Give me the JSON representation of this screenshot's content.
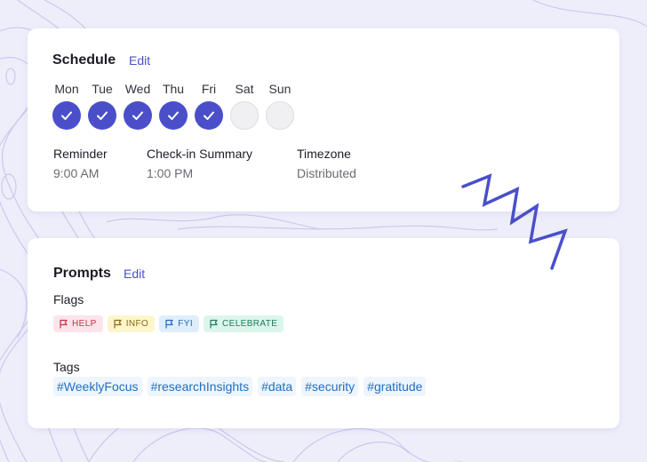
{
  "schedule": {
    "title": "Schedule",
    "edit_label": "Edit",
    "days": [
      {
        "label": "Mon",
        "checked": true
      },
      {
        "label": "Tue",
        "checked": true
      },
      {
        "label": "Wed",
        "checked": true
      },
      {
        "label": "Thu",
        "checked": true
      },
      {
        "label": "Fri",
        "checked": true
      },
      {
        "label": "Sat",
        "checked": false
      },
      {
        "label": "Sun",
        "checked": false
      }
    ],
    "reminder": {
      "label": "Reminder",
      "value": "9:00 AM"
    },
    "checkin": {
      "label": "Check-in Summary",
      "value": "1:00 PM"
    },
    "timezone": {
      "label": "Timezone",
      "value": "Distributed"
    }
  },
  "prompts": {
    "title": "Prompts",
    "edit_label": "Edit",
    "flags_label": "Flags",
    "flags": [
      {
        "label": "HELP",
        "bg": "#fce4ea",
        "color": "#c2334d",
        "icon": "flag-icon"
      },
      {
        "label": "INFO",
        "bg": "#fdf6cc",
        "color": "#8a6b10",
        "icon": "flag-icon"
      },
      {
        "label": "FYI",
        "bg": "#dfeefb",
        "color": "#2268b8",
        "icon": "flag-icon"
      },
      {
        "label": "CELEBRATE",
        "bg": "#dcf6ec",
        "color": "#1d7a56",
        "icon": "flag-icon"
      }
    ],
    "tags_label": "Tags",
    "tags": [
      "#WeeklyFocus",
      "#researchInsights",
      "#data",
      "#security",
      "#gratitude"
    ]
  },
  "colors": {
    "accent": "#4a4fc9",
    "background": "#eeeefb",
    "tag_text": "#1f6fc0"
  }
}
